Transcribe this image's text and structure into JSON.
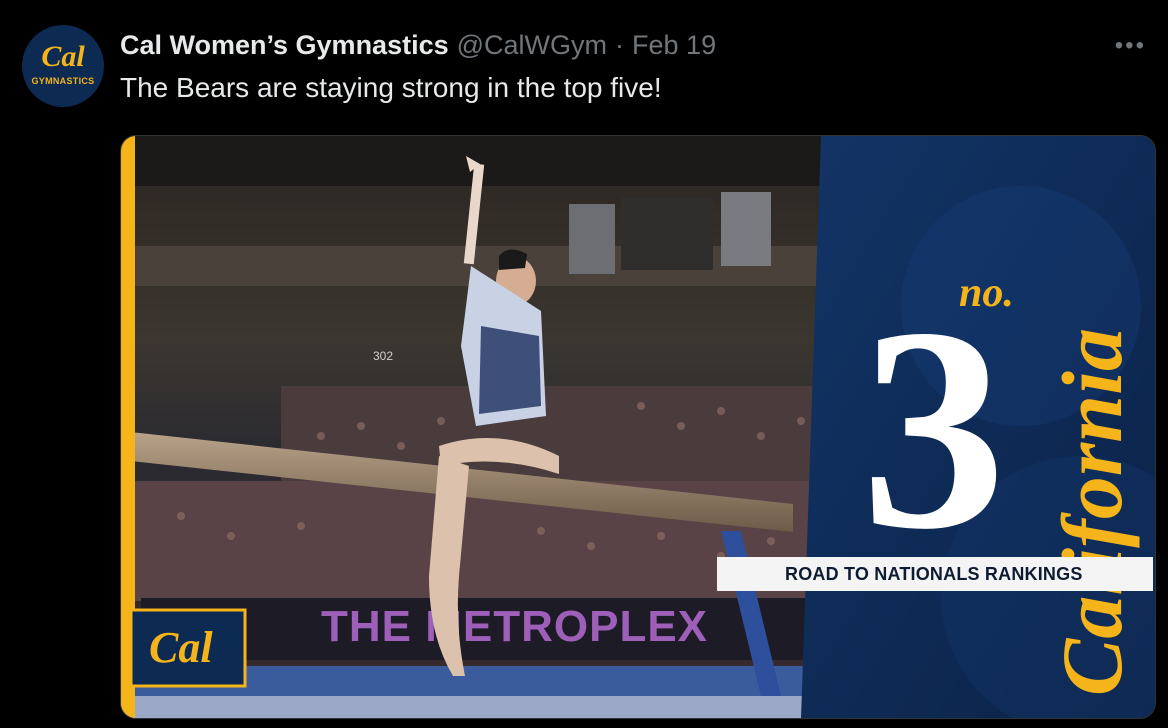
{
  "tweet": {
    "avatar": {
      "logo_text": "Cal",
      "sub_text": "GYMNASTICS"
    },
    "display_name": "Cal Women’s Gymnastics",
    "handle": "@CalWGym",
    "separator": "·",
    "date": "Feb 19",
    "more_icon": "more-horizontal-icon",
    "text": "The Bears are staying strong in the top five!"
  },
  "media": {
    "rank_prefix": "no.",
    "rank_number": "3",
    "rank_label": "ROAD TO NATIONALS RANKINGS",
    "script_word": "California",
    "corner_logo": "Cal",
    "banner_text": "THE METROPLEX",
    "section_number": "302",
    "colors": {
      "navy": "#0d2a52",
      "gold": "#f4b41a",
      "white": "#ffffff"
    }
  }
}
